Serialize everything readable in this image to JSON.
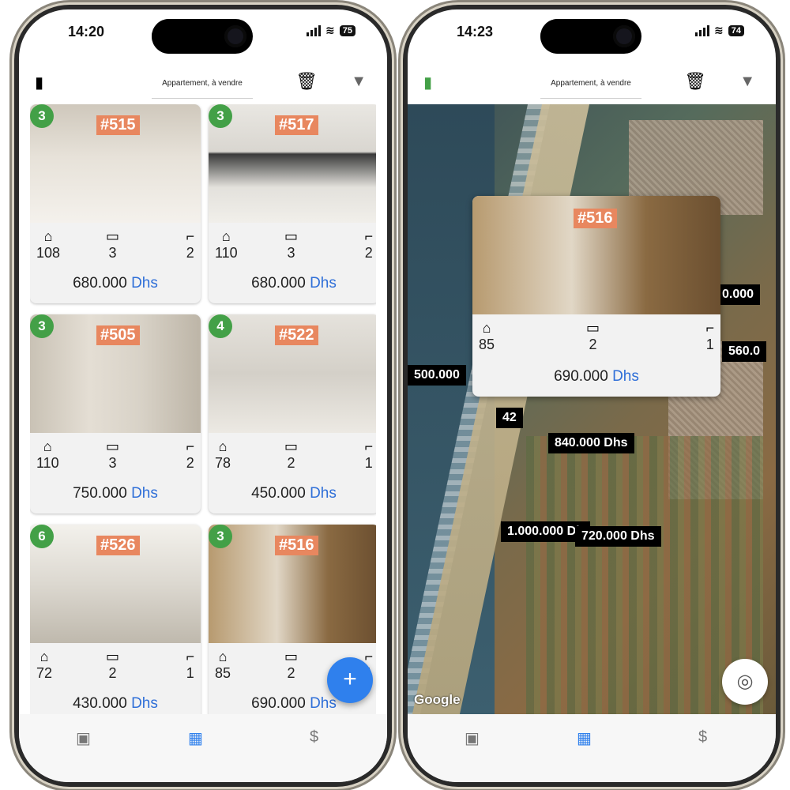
{
  "left_phone": {
    "status": {
      "time": "14:20",
      "battery": "75"
    },
    "appbar": {
      "title": "Appartement, à vendre"
    },
    "cards": [
      {
        "count": "3",
        "ref": "#515",
        "area": "108",
        "rooms": "3",
        "baths": "2",
        "price": "680.000",
        "currency": "Dhs"
      },
      {
        "count": "3",
        "ref": "#517",
        "area": "110",
        "rooms": "3",
        "baths": "2",
        "price": "680.000",
        "currency": "Dhs"
      },
      {
        "count": "3",
        "ref": "#505",
        "area": "110",
        "rooms": "3",
        "baths": "2",
        "price": "750.000",
        "currency": "Dhs"
      },
      {
        "count": "4",
        "ref": "#522",
        "area": "78",
        "rooms": "2",
        "baths": "1",
        "price": "450.000",
        "currency": "Dhs"
      },
      {
        "count": "6",
        "ref": "#526",
        "area": "72",
        "rooms": "2",
        "baths": "1",
        "price": "430.000",
        "currency": "Dhs"
      },
      {
        "count": "3",
        "ref": "#516",
        "area": "85",
        "rooms": "2",
        "baths": "1",
        "price": "690.000",
        "currency": "Dhs"
      }
    ],
    "fab": "+"
  },
  "right_phone": {
    "status": {
      "time": "14:23",
      "battery": "74"
    },
    "appbar": {
      "title": "Appartement, à vendre"
    },
    "popup": {
      "ref": "#516",
      "area": "85",
      "rooms": "2",
      "baths": "1",
      "price": "690.000",
      "currency": "Dhs"
    },
    "price_tags": [
      "500.000",
      "0.000",
      "560.0",
      "42",
      "840.000 Dhs",
      "1.000.000 Dh",
      "720.000 Dhs"
    ],
    "map_brand": "Google"
  },
  "icons": {
    "map": "▮",
    "trash": "🗑",
    "filter": "⏷",
    "house": "⌂",
    "bed": "🛏",
    "shower": "🚿",
    "store": "▣",
    "building": "▦",
    "dollar": "$",
    "locate": "◎"
  },
  "colors": {
    "accent": "#2f80ed",
    "badge": "#43a047",
    "ref_tag": "#e8875f"
  }
}
